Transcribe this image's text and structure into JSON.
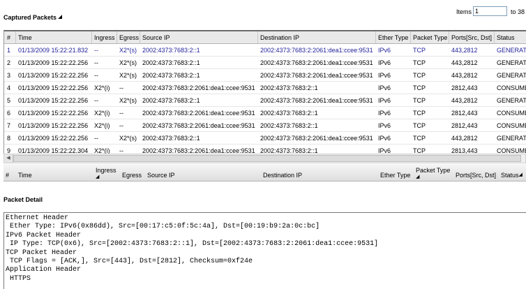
{
  "captured": {
    "title": "Captured Packets",
    "items_label": "Items",
    "items_value": "1",
    "items_to": "to 38"
  },
  "columns": [
    "#",
    "Time",
    "Ingress",
    "Egress",
    "Source IP",
    "Destination IP",
    "Ether Type",
    "Packet Type",
    "Ports[Src, Dst]",
    "Status"
  ],
  "rows": [
    [
      "1",
      "01/13/2009 15:22:21.832",
      "--",
      "X2*(s)",
      "2002:4373:7683:2::1",
      "2002:4373:7683:2:2061:dea1:ccee:9531",
      "IPv6",
      "TCP",
      "443,2812",
      "GENERATED"
    ],
    [
      "2",
      "01/13/2009 15:22:22.256",
      "--",
      "X2*(s)",
      "2002:4373:7683:2::1",
      "2002:4373:7683:2:2061:dea1:ccee:9531",
      "IPv6",
      "TCP",
      "443,2812",
      "GENERATED"
    ],
    [
      "3",
      "01/13/2009 15:22:22.256",
      "--",
      "X2*(s)",
      "2002:4373:7683:2::1",
      "2002:4373:7683:2:2061:dea1:ccee:9531",
      "IPv6",
      "TCP",
      "443,2812",
      "GENERATED"
    ],
    [
      "4",
      "01/13/2009 15:22:22.256",
      "X2*(i)",
      "--",
      "2002:4373:7683:2:2061:dea1:ccee:9531",
      "2002:4373:7683:2::1",
      "IPv6",
      "TCP",
      "2812,443",
      "CONSUMED"
    ],
    [
      "5",
      "01/13/2009 15:22:22.256",
      "--",
      "X2*(s)",
      "2002:4373:7683:2::1",
      "2002:4373:7683:2:2061:dea1:ccee:9531",
      "IPv6",
      "TCP",
      "443,2812",
      "GENERATED"
    ],
    [
      "6",
      "01/13/2009 15:22:22.256",
      "X2*(i)",
      "--",
      "2002:4373:7683:2:2061:dea1:ccee:9531",
      "2002:4373:7683:2::1",
      "IPv6",
      "TCP",
      "2812,443",
      "CONSUMED"
    ],
    [
      "7",
      "01/13/2009 15:22:22.256",
      "X2*(i)",
      "--",
      "2002:4373:7683:2:2061:dea1:ccee:9531",
      "2002:4373:7683:2::1",
      "IPv6",
      "TCP",
      "2812,443",
      "CONSUMED"
    ],
    [
      "8",
      "01/13/2009 15:22:22.256",
      "--",
      "X2*(s)",
      "2002:4373:7683:2::1",
      "2002:4373:7683:2:2061:dea1:ccee:9531",
      "IPv6",
      "TCP",
      "443,2812",
      "GENERATED"
    ],
    [
      "9",
      "01/13/2009 15:22:22.304",
      "X2*(i)",
      "--",
      "2002:4373:7683:2:2061:dea1:ccee:9531",
      "2002:4373:7683:2::1",
      "IPv6",
      "TCP",
      "2813,443",
      "CONSUMED"
    ]
  ],
  "selected_row": 0,
  "selected_color": "#1d1d9a",
  "secondary_header": {
    "num": "#",
    "time": "Time",
    "ingress": "Ingress",
    "egress": "Egress",
    "source": "Source IP",
    "destination": "Destination IP",
    "ether": "Ether Type",
    "packet": "Packet Type",
    "ports": "Ports[Src, Dst]",
    "status": "Status"
  },
  "detail": {
    "title": "Packet Detail",
    "lines": [
      "Ethernet Header",
      " Ether Type: IPv6(0x86dd), Src=[00:17:c5:0f:5c:4a], Dst=[00:19:b9:2a:0c:bc]",
      "IPv6 Packet Header",
      " IP Type: TCP(0x6), Src=[2002:4373:7683:2::1], Dst=[2002:4373:7683:2:2061:dea1:ccee:9531]",
      "TCP Packet Header",
      " TCP Flags = [ACK,], Src=[443], Dst=[2812], Checksum=0xf24e",
      "Application Header",
      " HTTPS"
    ]
  }
}
